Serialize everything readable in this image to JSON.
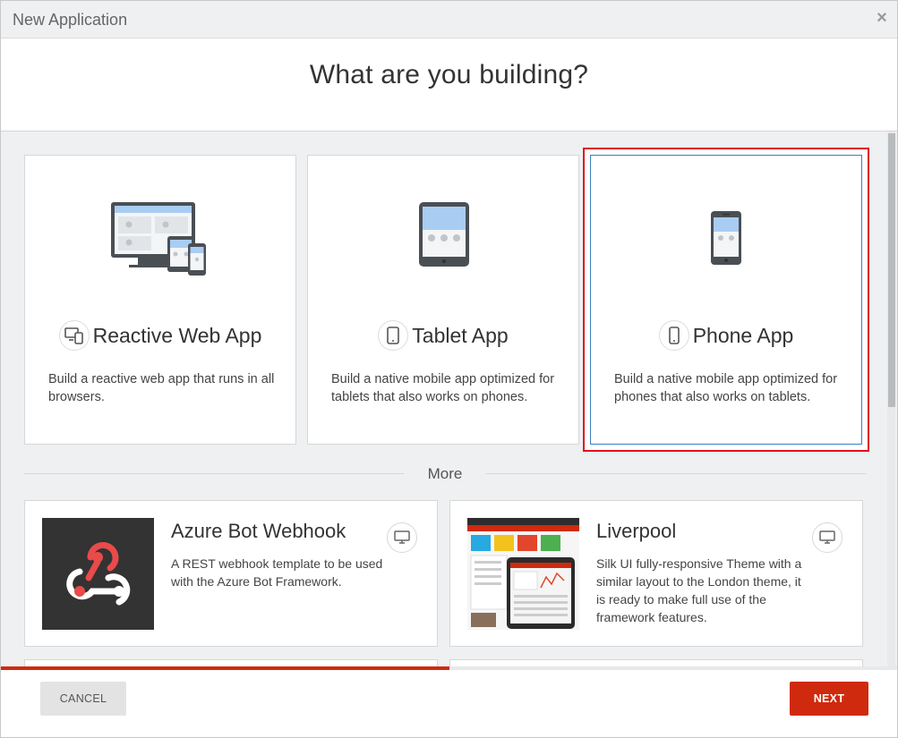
{
  "window": {
    "title": "New Application",
    "close_icon": "×"
  },
  "header": {
    "title": "What are you building?"
  },
  "app_types": [
    {
      "name": "Reactive Web App",
      "icon": "multi-device-icon",
      "description": "Build a reactive web app that runs in all browsers.",
      "selected": false
    },
    {
      "name": "Tablet App",
      "icon": "tablet-icon",
      "description": "Build a native mobile app optimized for tablets that also works on phones.",
      "selected": false
    },
    {
      "name": "Phone App",
      "icon": "phone-icon",
      "description": "Build a native mobile app optimized for phones that also works on tablets.",
      "selected": true
    }
  ],
  "more": {
    "label": "More"
  },
  "templates": [
    {
      "name": "Azure Bot Webhook",
      "description": "A REST webhook template to be used with the Azure Bot Framework.",
      "platform_icon": "monitor-icon"
    },
    {
      "name": "Liverpool",
      "description": "Silk UI fully-responsive Theme with a similar layout to the London theme, it is ready to make full use of the framework features.",
      "platform_icon": "monitor-icon"
    }
  ],
  "footer": {
    "cancel_label": "CANCEL",
    "next_label": "NEXT",
    "progress_fraction": 0.5
  },
  "colors": {
    "accent_red": "#cf2a0e",
    "selection_outline": "#e20d1b",
    "selected_border": "#3a7fc1",
    "content_bg": "#eef0f1"
  }
}
